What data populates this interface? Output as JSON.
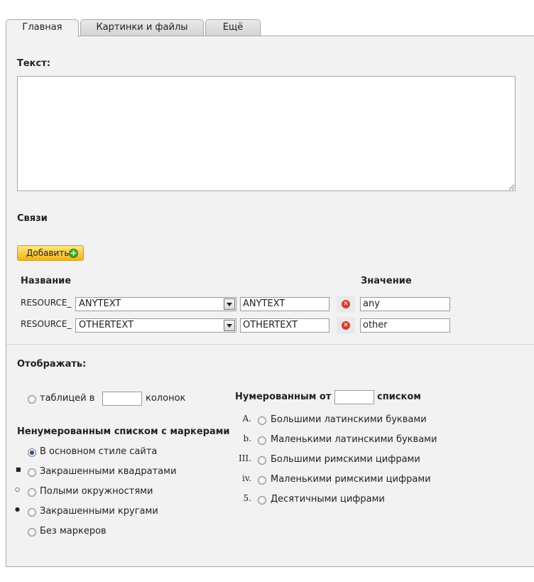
{
  "tabs": [
    {
      "label": "Главная",
      "active": true
    },
    {
      "label": "Картинки и файлы",
      "active": false
    },
    {
      "label": "Ещё",
      "active": false
    }
  ],
  "text_section": {
    "label": "Текст:",
    "value": ""
  },
  "links_section": {
    "title": "Связи",
    "add_button": "Добавить",
    "col_name": "Название",
    "col_value": "Значение",
    "rows": [
      {
        "prefix": "RESOURCE_",
        "select": "ANYTEXT",
        "name": "ANYTEXT",
        "value": "any"
      },
      {
        "prefix": "RESOURCE_",
        "select": "OTHERTEXT",
        "name": "OTHERTEXT",
        "value": "other"
      }
    ]
  },
  "display": {
    "title": "Отображать:",
    "table_option": {
      "before": "таблицей в",
      "after": "колонок",
      "columns": ""
    },
    "unordered": {
      "title": "Ненумерованным списком с маркерами",
      "options": [
        {
          "marker": "",
          "label": "В основном стиле сайта",
          "selected": true
        },
        {
          "marker": "■",
          "label": "Закрашенными квадратами",
          "selected": false
        },
        {
          "marker": "○",
          "label": "Полыми окружностями",
          "selected": false
        },
        {
          "marker": "●",
          "label": "Закрашенными кругами",
          "selected": false
        },
        {
          "marker": "",
          "label": "Без маркеров",
          "selected": false
        }
      ]
    },
    "ordered": {
      "title_before": "Нумерованным от",
      "title_after": "списком",
      "start": "",
      "options": [
        {
          "marker": "A.",
          "label": "Большими латинскими буквами",
          "selected": false
        },
        {
          "marker": "b.",
          "label": "Маленькими латинскими буквами",
          "selected": false
        },
        {
          "marker": "III.",
          "label": "Большими римскими цифрами",
          "selected": false
        },
        {
          "marker": "iv.",
          "label": "Маленькими римскими цифрами",
          "selected": false
        },
        {
          "marker": "5.",
          "label": "Десятичными цифрами",
          "selected": false
        }
      ]
    }
  }
}
